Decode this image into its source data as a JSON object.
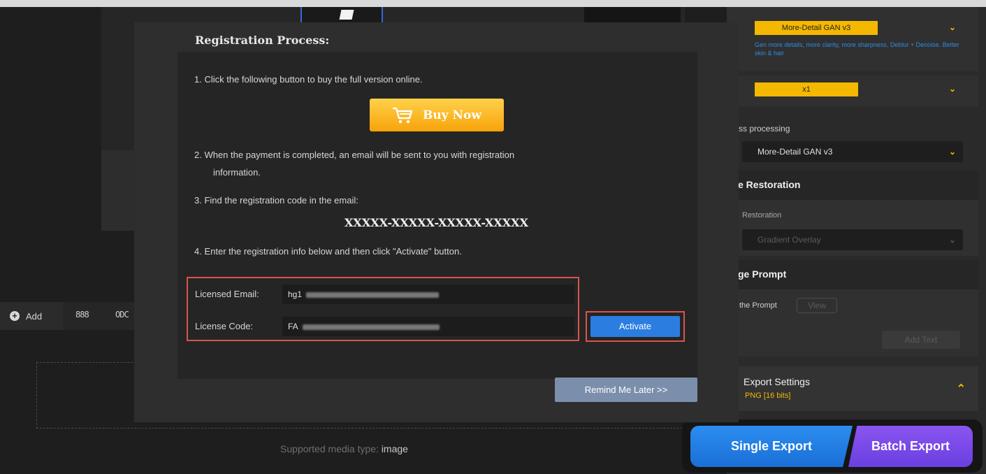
{
  "background": {
    "toolbar": {
      "add_label": "Add",
      "grid_icon": "888",
      "strip_icon": "ODC"
    },
    "supported_label": "Supported media type:",
    "supported_value": "image"
  },
  "right_panel": {
    "model_select": "More-Detail GAN  v3",
    "model_hint": "Gen more details, more clarity, more sharpness, Deblur + Denoise. Better skin & hair",
    "scale_select": "x1",
    "post_processing_label": "ss processing",
    "post_model_select": "More-Detail GAN  v3",
    "restoration_title": "e Restoration",
    "restoration_label": "Restoration",
    "restoration_select": "Gradient Overlay",
    "prompt_title": "ge Prompt",
    "prompt_label": "the Prompt",
    "view_label": "View",
    "add_text_label": "Add Text",
    "export_settings_title": "Export Settings",
    "export_settings_value": "PNG  [16 bits]",
    "single_export": "Single Export",
    "batch_export": "Batch Export"
  },
  "modal": {
    "title": "Registration Process:",
    "step1": "1.  Click the following button to buy the full version online.",
    "buy_now": "Buy Now",
    "step2_line1": "2.  When the payment is completed, an email will be sent to you with registration",
    "step2_line2": "information.",
    "step3": "3.  Find the registration code in the email:",
    "code_sample": "XXXXX-XXXXX-XXXXX-XXXXX",
    "step4": "4.  Enter the registration info below and then click \"Activate\" button.",
    "email_label": "Licensed Email:",
    "email_value": "hg1",
    "code_label": "License Code:",
    "code_value": "FA",
    "activate": "Activate",
    "remind_later": "Remind Me Later >>"
  },
  "colors": {
    "accent_yellow": "#f5b800",
    "highlight_red": "#d9534f",
    "activate_blue": "#2b7de0",
    "single_export_blue": "#1a6fd6",
    "batch_export_purple": "#6a3fe0"
  }
}
